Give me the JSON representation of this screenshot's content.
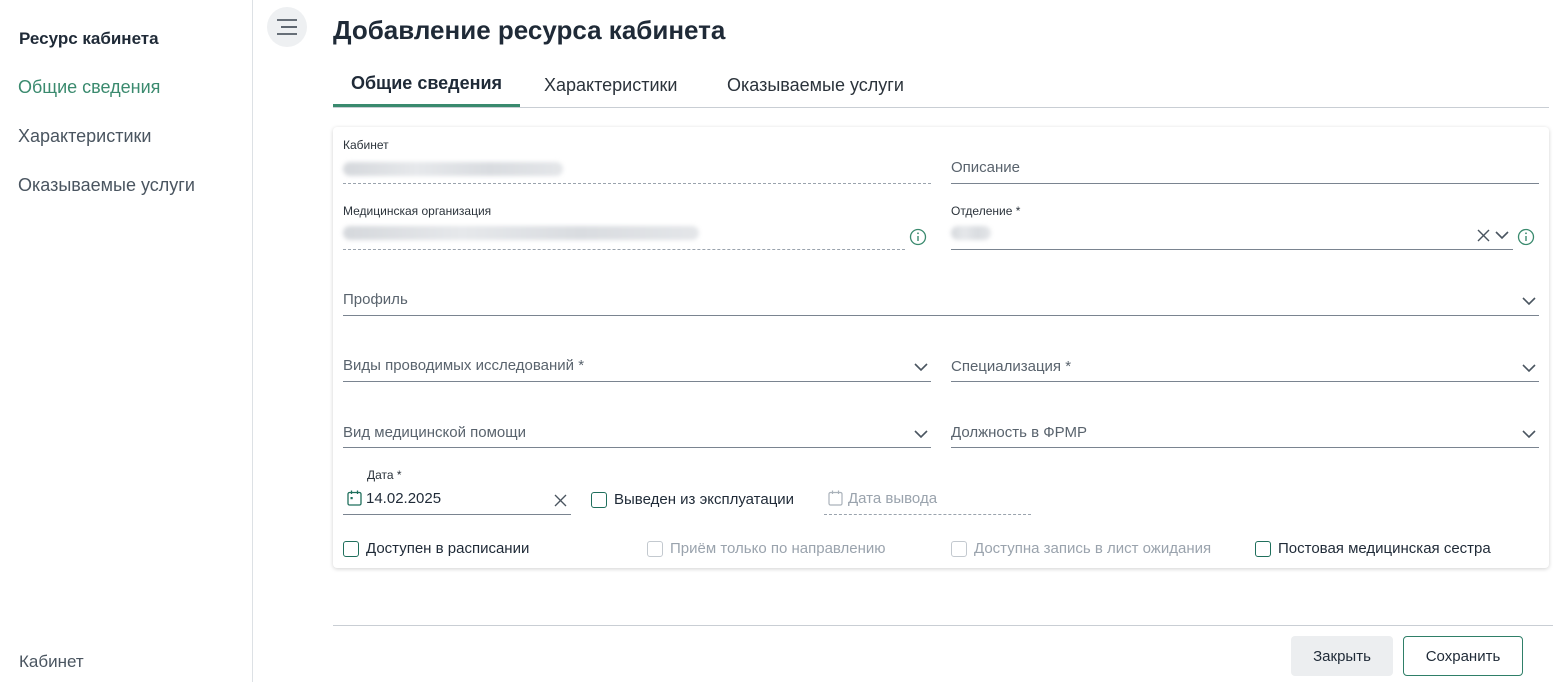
{
  "sidebar": {
    "title": "Ресурс кабинета",
    "items": [
      {
        "label": "Общие сведения",
        "active": true
      },
      {
        "label": "Характеристики",
        "active": false
      },
      {
        "label": "Оказываемые услуги",
        "active": false
      }
    ],
    "footer": "Кабинет"
  },
  "header": {
    "title": "Добавление ресурса кабинета"
  },
  "tabs": [
    {
      "label": "Общие сведения",
      "active": true
    },
    {
      "label": "Характеристики",
      "active": false
    },
    {
      "label": "Оказываемые услуги",
      "active": false
    }
  ],
  "form": {
    "cabinet": {
      "label": "Кабинет"
    },
    "description": {
      "placeholder": "Описание"
    },
    "med_org": {
      "label": "Медицинская организация"
    },
    "department": {
      "label": "Отделение *"
    },
    "profile": {
      "placeholder": "Профиль"
    },
    "research_types": {
      "placeholder": "Виды проводимых исследований *"
    },
    "specialization": {
      "placeholder": "Специализация *"
    },
    "care_type": {
      "placeholder": "Вид медицинской помощи"
    },
    "frmr_position": {
      "placeholder": "Должность в ФРМР"
    },
    "date": {
      "label": "Дата *",
      "value": "14.02.2025"
    },
    "decommissioned": {
      "label": "Выведен из эксплуатации"
    },
    "decommission_date": {
      "placeholder": "Дата вывода"
    },
    "checkboxes": {
      "available_schedule": "Доступен в расписании",
      "referral_only": "Приём только по направлению",
      "waitlist": "Доступна запись в лист ожидания",
      "ward_nurse": "Постовая медицинская сестра"
    }
  },
  "buttons": {
    "close": "Закрыть",
    "save": "Сохранить"
  },
  "colors": {
    "accent": "#3a8a6e",
    "accent_dark": "#1f6f5c"
  }
}
